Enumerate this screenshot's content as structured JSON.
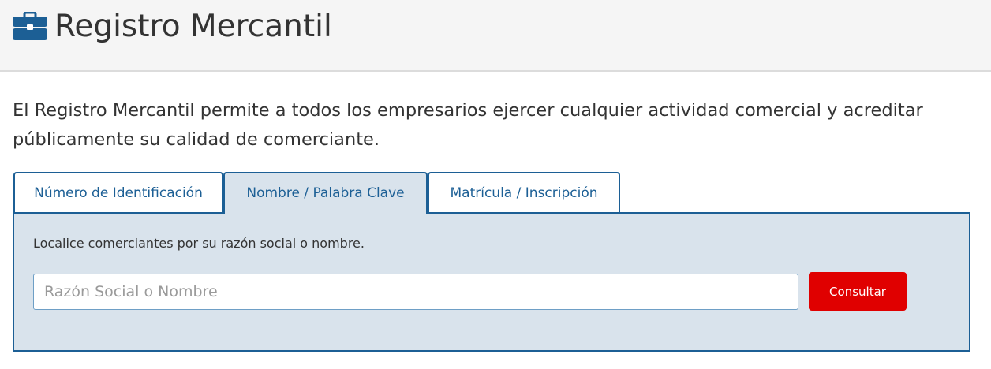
{
  "header": {
    "title": "Registro Mercantil",
    "icon": "briefcase-icon",
    "icon_color": "#1c5f95"
  },
  "intro": {
    "text": "El Registro Mercantil permite a todos los empresarios ejercer cualquier actividad comercial y acreditar públicamente su calidad de comerciante."
  },
  "tabs": [
    {
      "label": "Número de Identificación",
      "active": false
    },
    {
      "label": "Nombre / Palabra Clave",
      "active": true
    },
    {
      "label": "Matrícula / Inscripción",
      "active": false
    }
  ],
  "panel": {
    "description": "Localice comerciantes por su razón social o nombre.",
    "search": {
      "placeholder": "Razón Social o Nombre",
      "value": ""
    },
    "submit_label": "Consultar"
  },
  "colors": {
    "accent": "#1c5f95",
    "panel_bg": "#d9e3ec",
    "button": "#e00000"
  }
}
